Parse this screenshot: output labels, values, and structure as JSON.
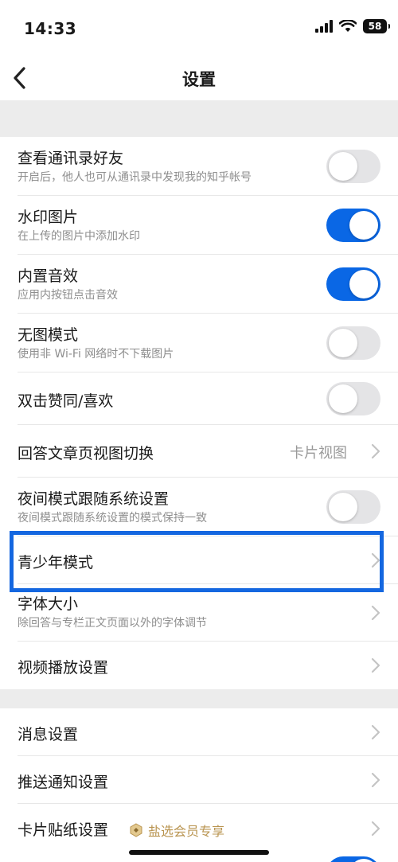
{
  "status_bar": {
    "time": "14:33",
    "battery": "58"
  },
  "nav": {
    "title": "设置"
  },
  "group1": [
    {
      "title": "查看通讯录好友",
      "subtitle": "开启后，他人也可从通讯录中发现我的知乎帐号",
      "control": "toggle",
      "on": false
    },
    {
      "title": "水印图片",
      "subtitle": "在上传的图片中添加水印",
      "control": "toggle",
      "on": true
    },
    {
      "title": "内置音效",
      "subtitle": "应用内按钮点击音效",
      "control": "toggle",
      "on": true
    },
    {
      "title": "无图模式",
      "subtitle": "使用非 Wi-Fi 网络时不下载图片",
      "control": "toggle",
      "on": false
    },
    {
      "title": "双击赞同/喜欢",
      "control": "toggle",
      "on": false
    },
    {
      "title": "回答文章页视图切换",
      "value": "卡片视图",
      "control": "chevron"
    },
    {
      "title": "夜间模式跟随系统设置",
      "subtitle": "夜间模式跟随系统设置的模式保持一致",
      "control": "toggle",
      "on": false
    },
    {
      "title": "青少年模式",
      "control": "chevron",
      "highlighted": true
    },
    {
      "title": "字体大小",
      "subtitle": "除回答与专栏正文页面以外的字体调节",
      "control": "chevron"
    },
    {
      "title": "视频播放设置",
      "control": "chevron"
    }
  ],
  "group2": [
    {
      "title": "消息设置",
      "control": "chevron"
    },
    {
      "title": "推送通知设置",
      "control": "chevron"
    },
    {
      "title": "卡片贴纸设置",
      "badge": "盐选会员专享",
      "control": "chevron"
    }
  ],
  "colors": {
    "toggle_on": "#0a67e5",
    "toggle_off": "#e4e4e6",
    "highlight_border": "#1467e0",
    "badge_gold": "#b99450",
    "background": "#ececec"
  },
  "icons": {
    "back": "chevron-left-icon",
    "row_arrow": "chevron-right-icon",
    "badge": "vip-hexagon-icon"
  }
}
